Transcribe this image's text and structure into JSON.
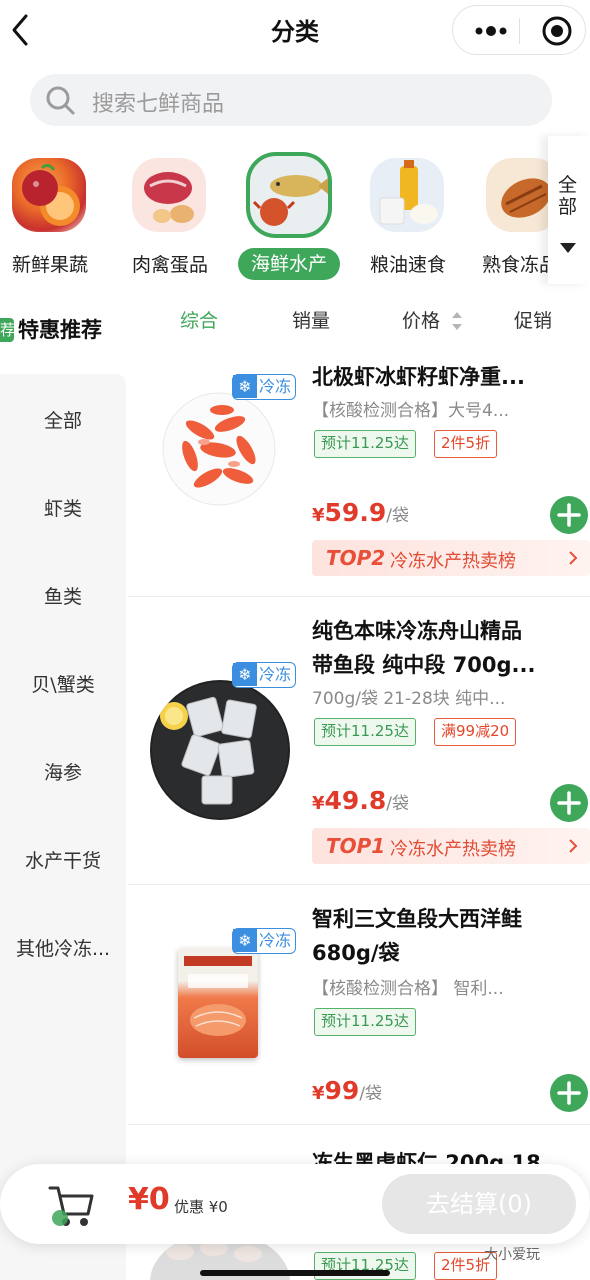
{
  "header": {
    "title": "分类",
    "back_icon": "chevron-left-icon",
    "more_icon": "more-dots-icon",
    "target_icon": "target-icon"
  },
  "search": {
    "placeholder": "搜索七鲜商品",
    "icon": "search-icon"
  },
  "categories": [
    {
      "label": "新鲜果蔬",
      "active": false
    },
    {
      "label": "肉禽蛋品",
      "active": false
    },
    {
      "label": "海鲜水产",
      "active": true
    },
    {
      "label": "粮油速食",
      "active": false
    },
    {
      "label": "熟食冻品",
      "active": false
    }
  ],
  "all_categories": {
    "label": "全部",
    "icon": "caret-down-icon"
  },
  "recommend": {
    "tag": "荐",
    "label": "特惠推荐"
  },
  "sidebar": {
    "items": [
      "全部",
      "虾类",
      "鱼类",
      "贝\\蟹类",
      "海参",
      "水产干货",
      "其他冷冻..."
    ]
  },
  "sort": {
    "items": [
      "综合",
      "销量",
      "价格",
      "促销"
    ],
    "active": "综合",
    "price_icon": "sort-arrows-icon"
  },
  "products": [
    {
      "name1": "北极虾冰虾籽虾净重...",
      "name2": "",
      "sub": "【核酸检测合格】大号4...",
      "frozen": "冷冻",
      "badges": [
        {
          "text": "预计11.25达",
          "type": "green"
        },
        {
          "text": "2件5折",
          "type": "red"
        }
      ],
      "currency": "¥",
      "price": "59.9",
      "unit": "/袋",
      "rank": {
        "top": "TOP2",
        "text": "冷冻水产热卖榜"
      }
    },
    {
      "name1": "纯色本味冷冻舟山精品",
      "name2": "带鱼段 纯中段 700g...",
      "sub": "700g/袋 21-28块 纯中...",
      "frozen": "冷冻",
      "badges": [
        {
          "text": "预计11.25达",
          "type": "green"
        },
        {
          "text": "满99减20",
          "type": "red"
        }
      ],
      "currency": "¥",
      "price": "49.8",
      "unit": "/袋",
      "rank": {
        "top": "TOP1",
        "text": "冷冻水产热卖榜"
      }
    },
    {
      "name1": "智利三文鱼段大西洋鲑",
      "name2": "680g/袋",
      "sub": "【核酸检测合格】 智利...",
      "frozen": "冷冻",
      "badges": [
        {
          "text": "预计11.25达",
          "type": "green"
        }
      ],
      "currency": "¥",
      "price": "99",
      "unit": "/袋"
    },
    {
      "name1": "冻生黑虎虾仁 200g 18",
      "badges": [
        {
          "text": "预计11.25达",
          "type": "green"
        },
        {
          "text": "2件5折",
          "type": "red"
        }
      ]
    }
  ],
  "cart": {
    "currency": "¥",
    "amount": "0",
    "discount": "优惠 ¥0",
    "checkout": "去结算(0)",
    "icon": "cart-icon"
  },
  "watermark": "大小爱玩",
  "colors": {
    "accent": "#3ea75a",
    "price": "#e03a2a",
    "frozen": "#3c8fe0"
  }
}
